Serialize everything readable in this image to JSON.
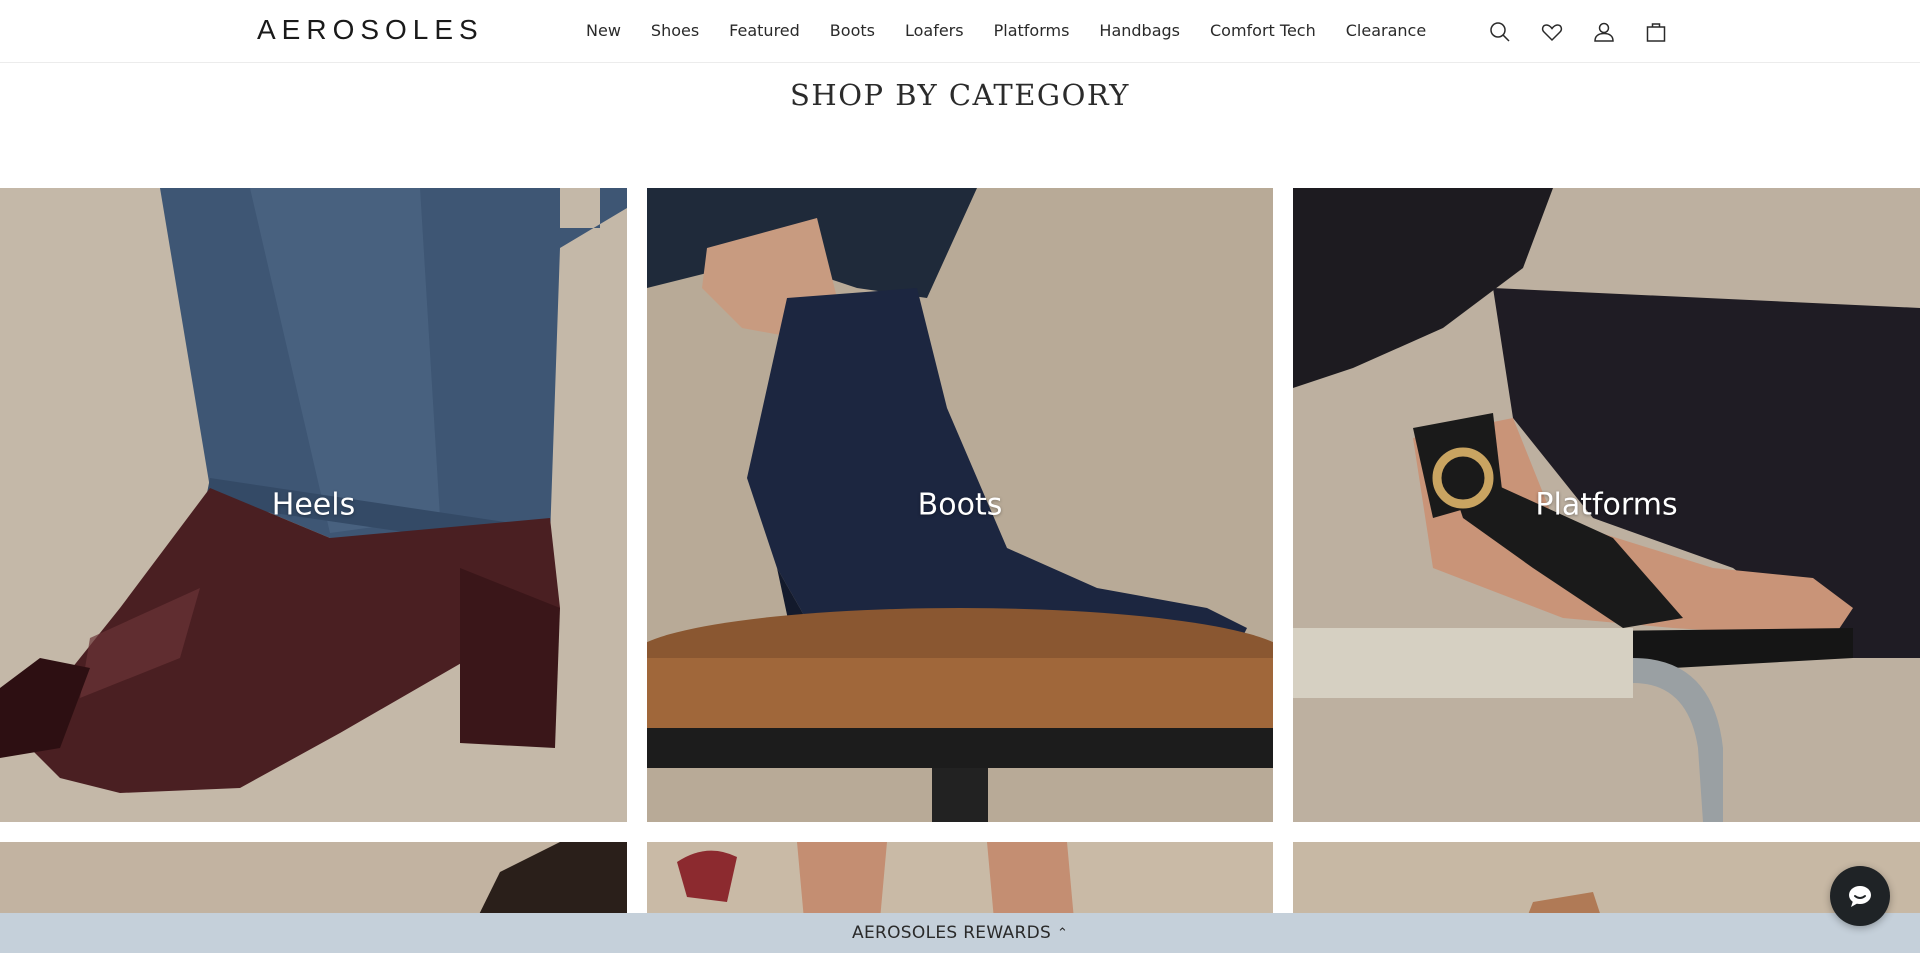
{
  "header": {
    "logo": "AEROSOLES",
    "nav": [
      "New",
      "Shoes",
      "Featured",
      "Boots",
      "Loafers",
      "Platforms",
      "Handbags",
      "Comfort Tech",
      "Clearance"
    ],
    "icons": [
      "search-icon",
      "heart-icon",
      "account-icon",
      "bag-icon"
    ]
  },
  "section": {
    "title": "SHOP BY CATEGORY"
  },
  "categories": [
    {
      "label": "Heels"
    },
    {
      "label": "Boots"
    },
    {
      "label": "Platforms"
    }
  ],
  "rewards": {
    "label": "AEROSOLES REWARDS",
    "chevron": "^"
  },
  "colors": {
    "rewards_bg": "#c5d0da",
    "chat_bg": "#1f2326",
    "text": "#2a2a2a"
  }
}
